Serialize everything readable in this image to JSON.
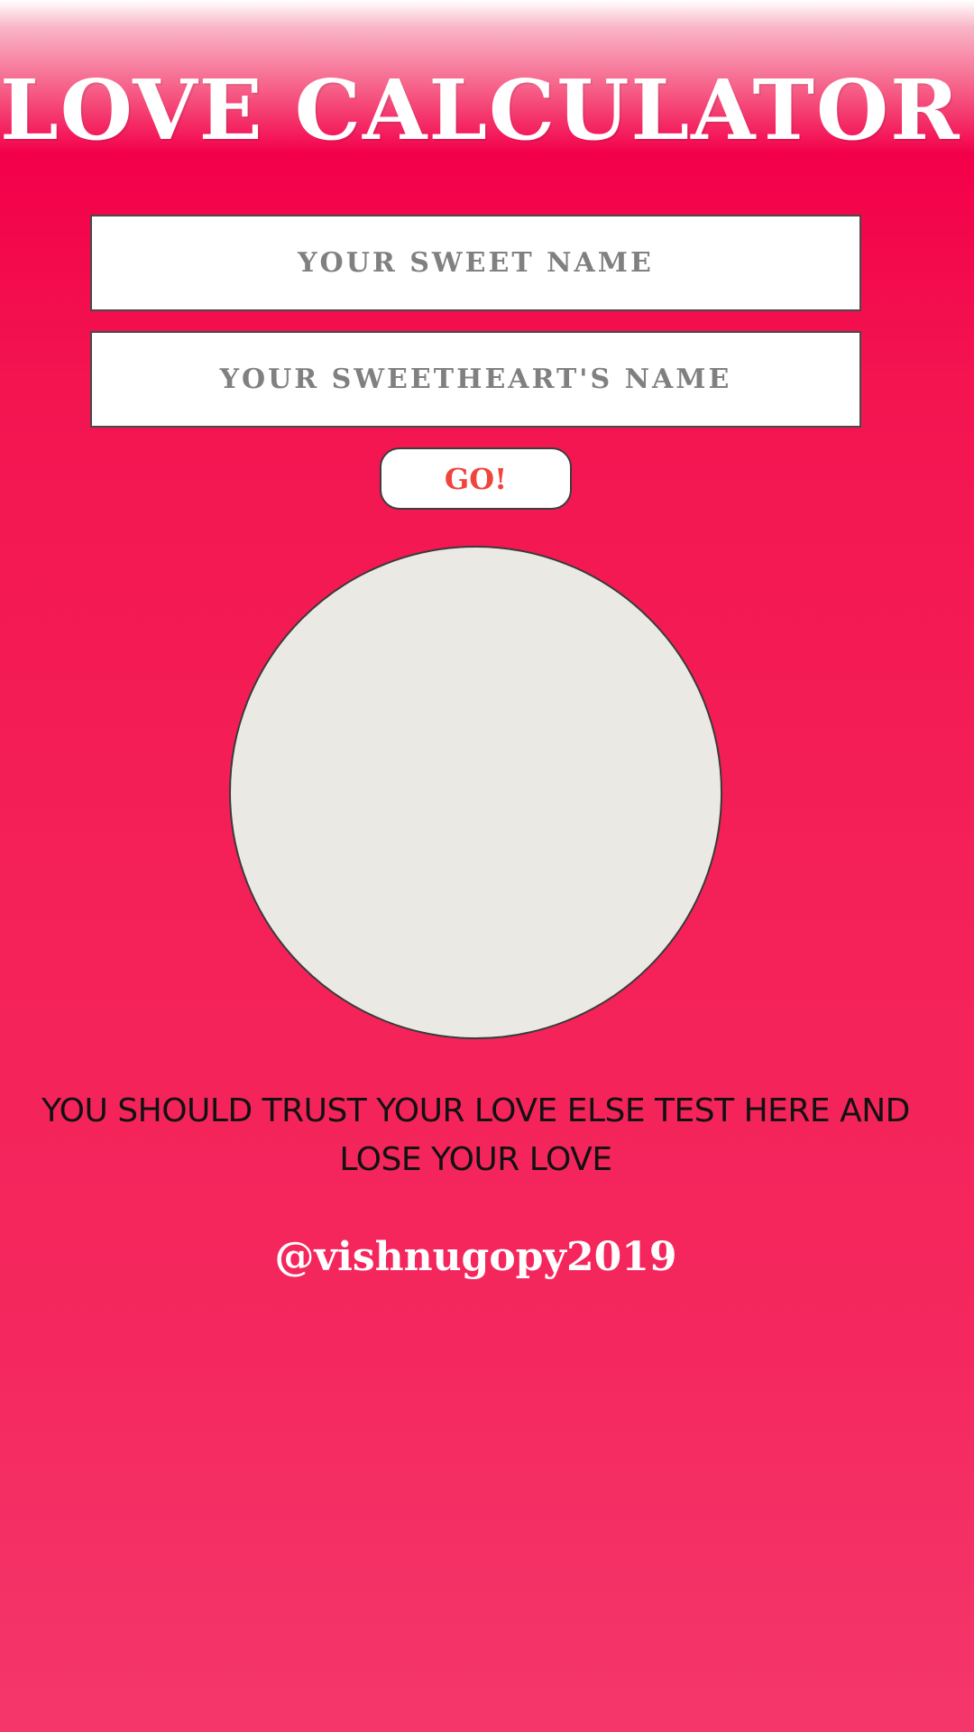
{
  "title": "LOVE CALCULATOR",
  "inputs": {
    "your_name_placeholder": "YOUR SWEET NAME",
    "sweetheart_name_placeholder": "YOUR SWEETHEART'S NAME"
  },
  "go_button_label": "GO!",
  "result": "",
  "message": "YOU SHOULD TRUST YOUR LOVE ELSE TEST HERE AND LOSE YOUR LOVE",
  "credit": "@vishnugopy2019",
  "colors": {
    "background_top": "#f3004a",
    "background_bottom": "#f4376b",
    "circle": "#ebe9e3",
    "go_text": "#f0443c"
  }
}
